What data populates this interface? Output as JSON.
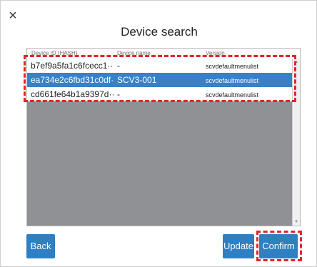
{
  "dialog": {
    "close_icon": "×",
    "title": "Device search"
  },
  "table": {
    "headers": {
      "device_id": "Device ID (HASH)",
      "device_name": "Device name",
      "version": "Version"
    },
    "rows": [
      {
        "device_id": "b7ef9a5fa1c6fcecc1···",
        "device_name": "-",
        "version": "scvdefaultmenulist",
        "selected": false
      },
      {
        "device_id": "ea734e2c6fbd31c0df···",
        "device_name": "SCV3-001",
        "version": "scvdefaultmenulist",
        "selected": true
      },
      {
        "device_id": "cd661fe64b1a9397d···",
        "device_name": "-",
        "version": "scvdefaultmenulist",
        "selected": false
      }
    ]
  },
  "buttons": {
    "back": "Back",
    "update": "Update",
    "confirm": "Confirm"
  },
  "colors": {
    "accent": "#2f7fc3",
    "selected_row": "#3a80c7",
    "list_background": "#8f9194",
    "highlight": "#e0262a"
  }
}
